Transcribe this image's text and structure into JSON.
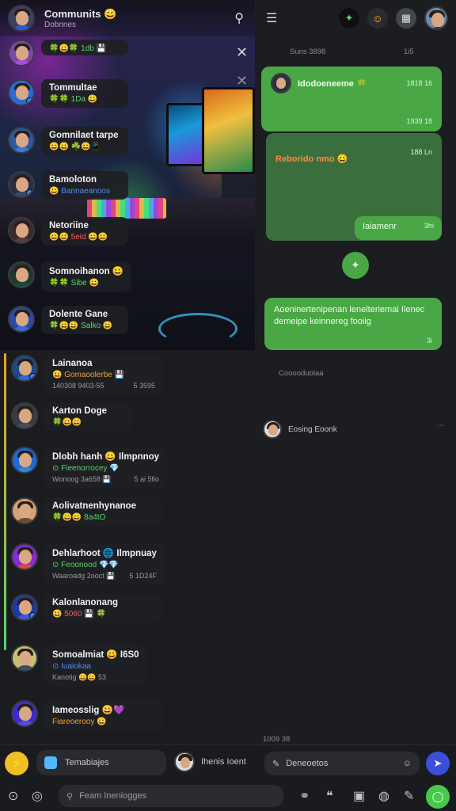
{
  "left_header": {
    "title": "Communits 😀",
    "subtitle": "Dobnnes"
  },
  "chats": [
    {
      "name": "",
      "line": "🍀😀🍀 1db 💾",
      "meta_left": "",
      "meta_right": "",
      "line_color": "#5dd36a",
      "avatar_bg": "#7a4aa8"
    },
    {
      "name": "Tommultae",
      "line": "🍀🍀 1Da 😀",
      "meta_left": "",
      "meta_right": "",
      "line_color": "#5dd36a",
      "avatar_bg": "#2a6ad8"
    },
    {
      "name": "Gomnilaet tarpe",
      "line": "😀😀 ☘️😀📱",
      "meta_left": "",
      "meta_right": "",
      "line_color": "#f0a032",
      "avatar_bg": "#2b5aa0"
    },
    {
      "name": "Bamoloton",
      "line": "😀 Bannaeanoos",
      "meta_left": "",
      "meta_right": "",
      "line_color": "#4f8dff",
      "avatar_bg": "#2a3040"
    },
    {
      "name": "Netoriine",
      "line": "😀😀 5eid 😀😀",
      "meta_left": "",
      "meta_right": "",
      "line_color": "#ff5a5a",
      "avatar_bg": "#3a2a2a"
    },
    {
      "name": "Somnoihanon 😀",
      "line": "🍀🍀 Sibe 😀",
      "meta_left": "",
      "meta_right": "",
      "line_color": "#5dd36a",
      "avatar_bg": "#1f3a2a"
    },
    {
      "name": "Dolente Gane",
      "line": "🍀😀😀 Salko 😀",
      "meta_left": "",
      "meta_right": "",
      "line_color": "#5dd36a",
      "avatar_bg": "#2a4aa8"
    },
    {
      "name": "Lainanoa",
      "line": "😀 Gomaoolerbe 💾",
      "meta_left": "140308 9403-55",
      "meta_right": "5 3595",
      "line_color": "#f0a032",
      "avatar_bg": "#1a4a8a"
    },
    {
      "name": "Karton Doge",
      "line": "🍀😀😀",
      "meta_left": "",
      "meta_right": "",
      "line_color": "#5dd36a",
      "avatar_bg": "#3a3a44"
    },
    {
      "name": "Dlobh hanh 😀 Ilmpnnoy",
      "line": "⊙ Fieenorrocey 💎",
      "meta_left": "Wonoog 3a658 💾",
      "meta_right": "5 ai 5fio",
      "line_color": "#5dd36a",
      "avatar_bg": "#1a6ad8"
    },
    {
      "name": "Aolivatnenhynanoe",
      "line": "🍀😀😀 8a4tO",
      "meta_left": "",
      "meta_right": "",
      "line_color": "#5dd36a",
      "avatar_bg": "#d8a070"
    },
    {
      "name": "Dehlarhoot 🌐 Ilmpnuay",
      "line": "⊙ Feoonood 💎💎",
      "meta_left": "Waaroadg 2ooct 💾",
      "meta_right": "5 1D24F",
      "line_color": "#5dd36a",
      "avatar_bg": "#8a2ad8"
    },
    {
      "name": "Kalonlanonang",
      "line": "😀 5060 💾 🍀",
      "meta_left": "",
      "meta_right": "",
      "line_color": "#ff5a5a",
      "avatar_bg": "#1a3aa8"
    },
    {
      "name": "Somoalmiat 😀 I6S0",
      "line": "⊙ Iuaiokaa",
      "meta_left": "Kanotig 😀😀 53",
      "meta_right": "",
      "line_color": "#4f8dff",
      "avatar_bg": "#c8c070"
    },
    {
      "name": "Iameosslig 😀💜",
      "line": "Fiareoerooy 😀",
      "meta_left": "",
      "meta_right": "",
      "line_color": "#f0a032",
      "avatar_bg": "#3a2ad8"
    }
  ],
  "right_messages": {
    "top_meta": "Suns 3898",
    "top_meta_time": "1i5",
    "msg1": {
      "name": "Idodoeneeme 🍀",
      "time_top": "1818 16",
      "time_bottom": "1939 18"
    },
    "msg2": {
      "name": "Reborido nmo 😀",
      "time_top": "188 Ln"
    },
    "msg3": {
      "text": "Iaiamenr",
      "time": "3hi"
    },
    "msg4": {
      "text": "Aoeninertenipenan lenelteriemai Ilenec demeipe keinnereg fooiig",
      "time": "3i"
    },
    "system1": "Cooooduolaa",
    "contact": {
      "name": "Eosing Eoonk"
    },
    "bottom_time": "1009 38"
  },
  "bottom_bar": {
    "left_input_label": "Temabiajes",
    "middle_name": "Ihenis Ioent",
    "right_input_label": "Deneoetos",
    "search_placeholder": "Feam Ineniogges"
  },
  "colors": {
    "accent_green": "#49a845",
    "dark_green": "#3b6e3d"
  }
}
